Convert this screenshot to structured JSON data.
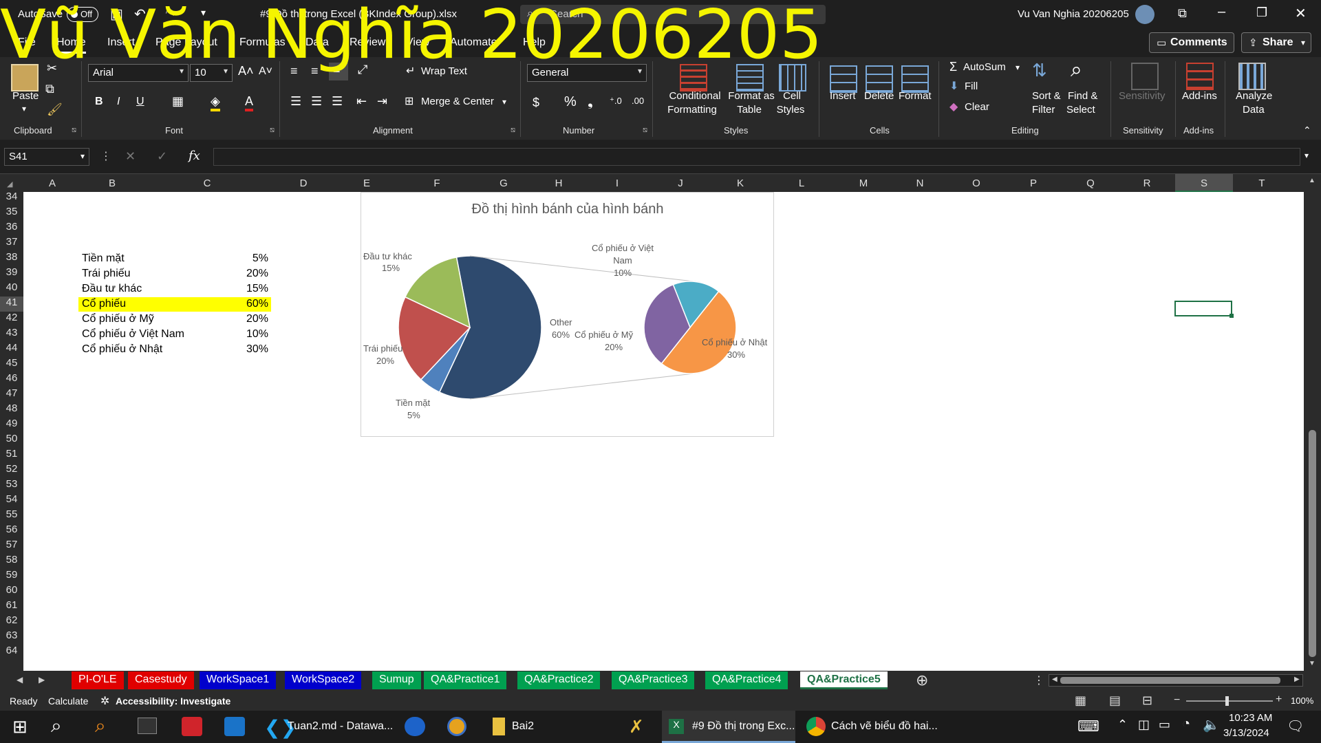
{
  "titlebar": {
    "autosave": "AutoSave",
    "autosave_state": "Off",
    "filename": "#9 Đồ thị trong Excel (BKIndex Group).xlsx",
    "search": "Search",
    "user": "Vu Van Nghia 20206205"
  },
  "ribbon_tabs": [
    "File",
    "Home",
    "Insert",
    "Page Layout",
    "Formulas",
    "Data",
    "Review",
    "View",
    "Automate",
    "Help"
  ],
  "comments_label": "Comments",
  "share_label": "Share",
  "ribbon": {
    "paste": "Paste",
    "font_name": "Arial",
    "font_size": "10",
    "wrap_text": "Wrap Text",
    "merge_center": "Merge & Center",
    "number_format": "General",
    "conditional_formatting": [
      "Conditional",
      "Formatting"
    ],
    "format_as_table": [
      "Format as",
      "Table"
    ],
    "cell_styles": [
      "Cell",
      "Styles"
    ],
    "insert": "Insert",
    "delete": "Delete",
    "format": "Format",
    "autosum": "AutoSum",
    "fill": "Fill",
    "clear": "Clear",
    "sort_filter": [
      "Sort &",
      "Filter"
    ],
    "find_select": [
      "Find &",
      "Select"
    ],
    "sensitivity": "Sensitivity",
    "addins": "Add-ins",
    "analyze_data": [
      "Analyze",
      "Data"
    ],
    "groups": {
      "clipboard": "Clipboard",
      "font": "Font",
      "alignment": "Alignment",
      "number": "Number",
      "styles": "Styles",
      "cells": "Cells",
      "editing": "Editing",
      "sensitivity": "Sensitivity",
      "addins": "Add-ins"
    }
  },
  "formula_bar": {
    "name_box": "S41",
    "fx": "fx",
    "value": ""
  },
  "columns": [
    "A",
    "B",
    "C",
    "D",
    "E",
    "F",
    "G",
    "H",
    "I",
    "J",
    "K",
    "L",
    "M",
    "N",
    "O",
    "P",
    "Q",
    "R",
    "S",
    "T"
  ],
  "selected_column": "S",
  "rows": [
    "34",
    "35",
    "36",
    "37",
    "38",
    "39",
    "40",
    "41",
    "42",
    "43",
    "44",
    "45",
    "46",
    "47",
    "48",
    "49",
    "50",
    "51",
    "52",
    "53",
    "54",
    "55",
    "56",
    "57",
    "58",
    "59",
    "60",
    "61",
    "62",
    "63",
    "64"
  ],
  "selected_row": "41",
  "table": [
    {
      "label": "Tiền mặt",
      "value": "5%"
    },
    {
      "label": "Trái phiếu",
      "value": "20%"
    },
    {
      "label": "Đầu tư khác",
      "value": "15%"
    },
    {
      "label": "Cổ phiếu",
      "value": "60%",
      "highlight": true
    },
    {
      "label": "Cổ phiếu ở Mỹ",
      "value": "20%"
    },
    {
      "label": "Cổ phiếu ở Việt Nam",
      "value": "10%"
    },
    {
      "label": "Cổ phiếu ở Nhật",
      "value": "30%"
    }
  ],
  "chart_data": {
    "type": "pie",
    "subtype": "pie-of-pie",
    "title": "Đồ thị hình bánh của hình bánh",
    "primary": [
      {
        "label": "Other",
        "value": 60,
        "pct": "60%",
        "color": "#2e4a6e"
      },
      {
        "label": "Tiền mặt",
        "value": 5,
        "pct": "5%",
        "color": "#4f81bd"
      },
      {
        "label": "Trái phiếu",
        "value": 20,
        "pct": "20%",
        "color": "#c0504d"
      },
      {
        "label": "Đầu tư khác",
        "value": 15,
        "pct": "15%",
        "color": "#9bbb59"
      }
    ],
    "secondary": [
      {
        "label": "Cổ phiếu ở Việt Nam",
        "value": 10,
        "pct": "10%",
        "color": "#4bacc6"
      },
      {
        "label": "Cổ phiếu ở Nhật",
        "value": 30,
        "pct": "30%",
        "color": "#f79646"
      },
      {
        "label": "Cổ phiếu ở Mỹ",
        "value": 20,
        "pct": "20%",
        "color": "#8064a2"
      }
    ],
    "labels": {
      "other": "Other",
      "other_pct": "60%",
      "tien_mat": "Tiền mặt",
      "tien_mat_pct": "5%",
      "trai_phieu": "Trái phiếu",
      "trai_phieu_pct": "20%",
      "dau_tu": "Đầu tư khác",
      "dau_tu_pct": "15%",
      "vn_l1": "Cổ phiếu ở Việt",
      "vn_l2": "Nam",
      "vn_pct": "10%",
      "nhat": "Cổ phiếu ở Nhật",
      "nhat_pct": "30%",
      "my": "Cổ phiếu ở Mỹ",
      "my_pct": "20%"
    }
  },
  "sheet_tabs": [
    {
      "name": "PI-O'LE",
      "color": "#e00000"
    },
    {
      "name": "Casestudy",
      "color": "#e00000"
    },
    {
      "name": "WorkSpace1",
      "color": "#0000cc"
    },
    {
      "name": "WorkSpace2",
      "color": "#0000cc"
    },
    {
      "name": "Sumup",
      "color": "#00a050"
    },
    {
      "name": "QA&Practice1",
      "color": "#00a050"
    },
    {
      "name": "QA&Practice2",
      "color": "#00a050"
    },
    {
      "name": "QA&Practice3",
      "color": "#00a050"
    },
    {
      "name": "QA&Practice4",
      "color": "#00a050"
    },
    {
      "name": "QA&Practice5",
      "color": "#ffffff",
      "active": true
    }
  ],
  "status": {
    "ready": "Ready",
    "calculate": "Calculate",
    "accessibility": "Accessibility: Investigate",
    "zoom": "100%"
  },
  "taskbar": {
    "vscode": "Tuan2.md - Datawa...",
    "folder": "Bai2",
    "excel": "#9 Đồ thị trong Exc...",
    "chrome": "Cách vẽ biểu đồ hai...",
    "time": "10:23 AM",
    "date": "3/13/2024"
  },
  "watermark": "Vũ Văn Nghĩa 20206205"
}
